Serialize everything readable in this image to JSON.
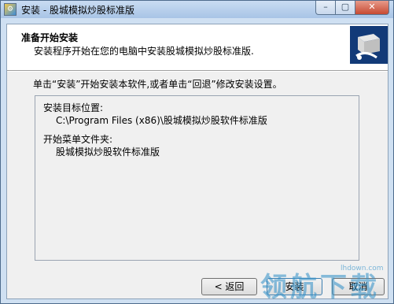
{
  "window": {
    "title": "安装 - 股城模拟炒股标准版",
    "app_icon": "installer-icon"
  },
  "header": {
    "title": "准备开始安装",
    "subtitle": "安装程序开始在您的电脑中安装股城模拟炒股标准版.",
    "image_icon": "computer-install-icon"
  },
  "body": {
    "intro": "单击“安装”开始安装本软件,或者单击“回退”修改安装设置。",
    "memo": {
      "dest_label": "安装目标位置:",
      "dest_value": "C:\\Program Files (x86)\\股城模拟炒股软件标准版",
      "menu_label": "开始菜单文件夹:",
      "menu_value": "股城模拟炒股软件标准版"
    }
  },
  "buttons": {
    "back": "< 返回",
    "next": "安装",
    "cancel": "取消"
  },
  "watermark": {
    "text": "领航下载",
    "url": "lhdown.com"
  }
}
